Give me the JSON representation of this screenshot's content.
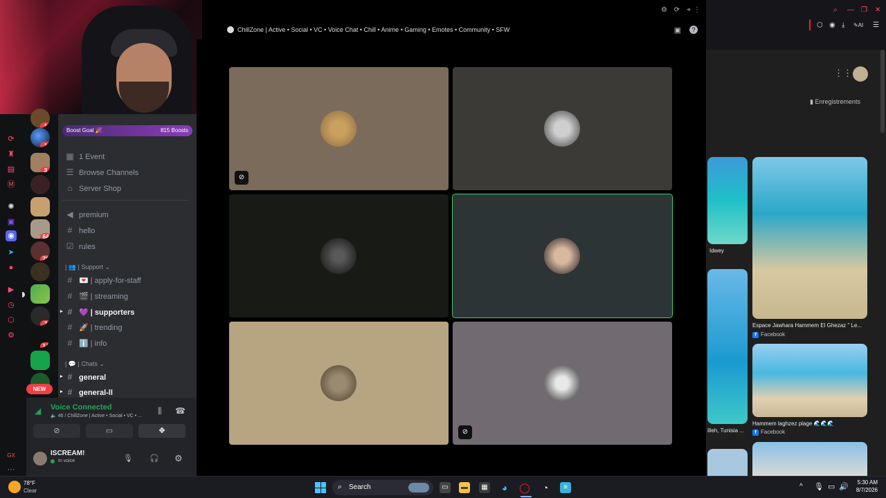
{
  "webcam": {
    "description_hidden": ""
  },
  "discord": {
    "boost": {
      "label": "Boost Goal 🎉",
      "count": "815 Boosts"
    },
    "top_links": [
      {
        "label": "1 Event"
      },
      {
        "label": "Browse Channels"
      },
      {
        "label": "Server Shop"
      }
    ],
    "channels": [
      {
        "name": "premium"
      },
      {
        "name": "hello"
      },
      {
        "name": "rules"
      }
    ],
    "support_category": "| 👥 | Support",
    "support_channels": [
      {
        "name": "| apply-for-staff",
        "emoji": "💌"
      },
      {
        "name": "| streaming",
        "emoji": "🎬"
      },
      {
        "name": "| supporters",
        "emoji": "💜"
      },
      {
        "name": "| trending",
        "emoji": "🚀"
      },
      {
        "name": "| info",
        "emoji": "ℹ️"
      }
    ],
    "chats_category": "| 💬 | Chats",
    "chat_channels": [
      {
        "name": "general"
      },
      {
        "name": "general-ll"
      }
    ],
    "server_badges": [
      "1",
      "1",
      "3",
      "64",
      "70",
      "7",
      "14"
    ],
    "new_badge": "NEW",
    "voice": {
      "status": "Voice Connected",
      "channel": "🔈 46 / ChillZone | Active • Social • VC • ..."
    },
    "user": {
      "name": "ISCREAM!",
      "status": "In voice"
    },
    "server_title": "ChillZone | Active • Social • VC • Voice Chat • Chill • Anime • Gaming • Emotes • Community • SFW"
  },
  "stage_tiles": [
    {
      "bg": "#7b6b5b",
      "muted": true
    },
    {
      "bg": "#3b3a36",
      "muted": false
    },
    {
      "bg": "#171a15",
      "muted": false
    },
    {
      "bg": "#2c3436",
      "muted": false,
      "speaking": true
    },
    {
      "bg": "#b7a581",
      "muted": false
    },
    {
      "bg": "#716a70",
      "muted": true
    }
  ],
  "browser": {
    "saved_label": "Enregistrements",
    "results": [
      {
        "caption": "Idwey"
      },
      {
        "caption": "Espace Jawhara Hammem El Ghezaz \" Le...",
        "source": "Facebook"
      },
      {
        "caption": "Hammem laghzez plage 🌊🌊🌊",
        "source": "Facebook"
      },
      {
        "caption": "illeh, Tunisia ..."
      }
    ]
  },
  "taskbar": {
    "weather_temp": "78°F",
    "weather_desc": "Clear",
    "search_label": "Search",
    "time": "5:30 AM",
    "date": "8/7/2026"
  },
  "colors": {
    "accent_green": "#23a55a",
    "badge_red": "#f23f43",
    "opera_red": "#ff1b2d"
  }
}
